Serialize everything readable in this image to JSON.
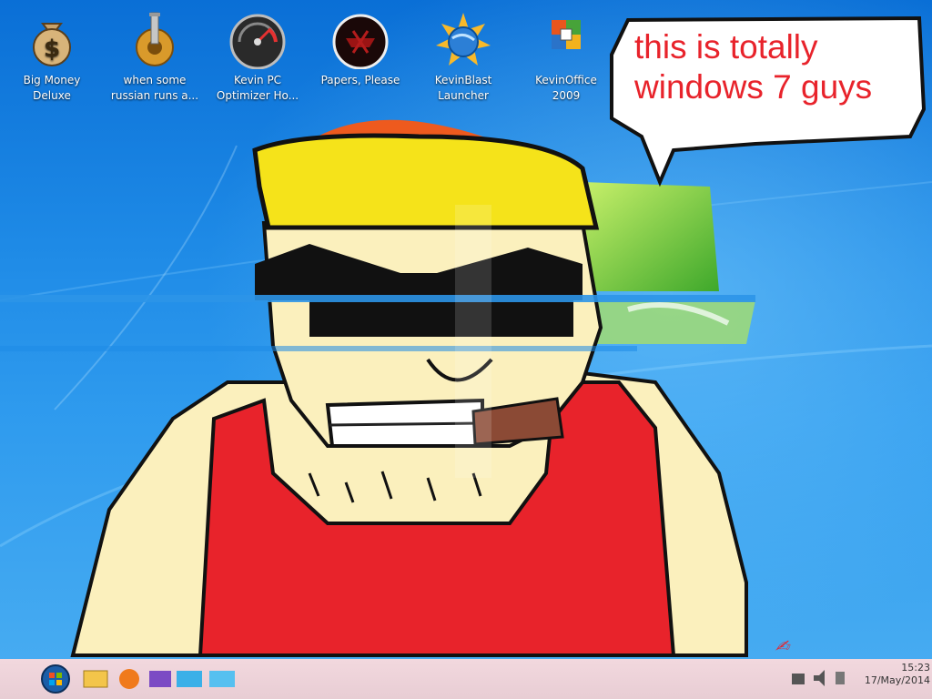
{
  "desktop": {
    "icons": [
      {
        "label": "Big Money\nDeluxe",
        "icon": "money-bag-icon"
      },
      {
        "label": "when some\nrussian runs a...",
        "icon": "gear-icon"
      },
      {
        "label": "Kevin PC\nOptimizer Ho...",
        "icon": "speedometer-icon"
      },
      {
        "label": "Papers, Please",
        "icon": "emblem-icon"
      },
      {
        "label": "KevinBlast\nLauncher",
        "icon": "globe-sun-icon"
      },
      {
        "label": "KevinOffice\n2009",
        "icon": "office-logo-icon"
      }
    ],
    "speech_bubble": "this is totally\nwindows 7 guys"
  },
  "taskbar": {
    "clock_time": "15:23",
    "clock_date": "17/May/2014"
  },
  "colors": {
    "desktop_bg": "#1e8ae6",
    "taskbar_bg": "#f2d8de",
    "speech_text": "#e8232b",
    "shirt": "#e8232b",
    "skin": "#fbf0bd",
    "hat": "#f5e31a"
  }
}
